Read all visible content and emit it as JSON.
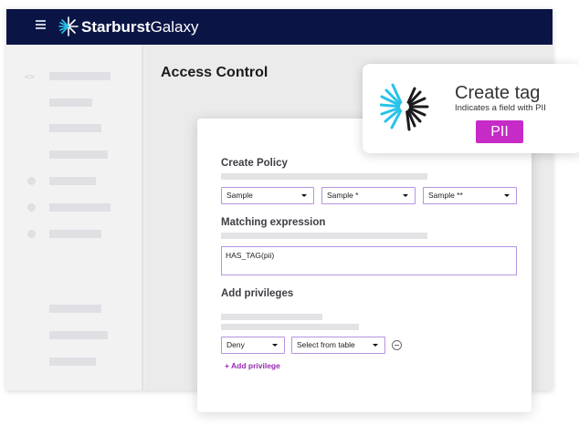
{
  "app": {
    "brand_bold": "Starburst",
    "brand_light": "Galaxy",
    "sidebar_code_icon": "<>"
  },
  "page": {
    "title": "Access Control"
  },
  "policy_form": {
    "create_policy_heading": "Create Policy",
    "selects": [
      "Sample",
      "Sample *",
      "Sample **"
    ],
    "matching_expression_heading": "Matching expression",
    "expression_value": "HAS_TAG(pii)",
    "add_privileges_heading": "Add privileges",
    "privilege_action": "Deny",
    "privilege_scope": "Select from table",
    "add_privilege_link": "+ Add privilege"
  },
  "tag_popup": {
    "title": "Create tag",
    "subtitle": "Indicates a field with PII",
    "badge": "PII"
  },
  "icons": {
    "menu": "hamburger-icon",
    "logo": "starburst-logo-icon",
    "code": "code-brackets-icon",
    "remove": "minus-circle-icon",
    "tag": "starburst-burst-icon",
    "dropdown": "caret-down-icon"
  },
  "colors": {
    "topbar": "#0b1545",
    "accent_purple": "#9a2ab0",
    "badge_magenta": "#c62ac7",
    "field_border": "#b494e0",
    "burst_cyan": "#27c3e8"
  }
}
